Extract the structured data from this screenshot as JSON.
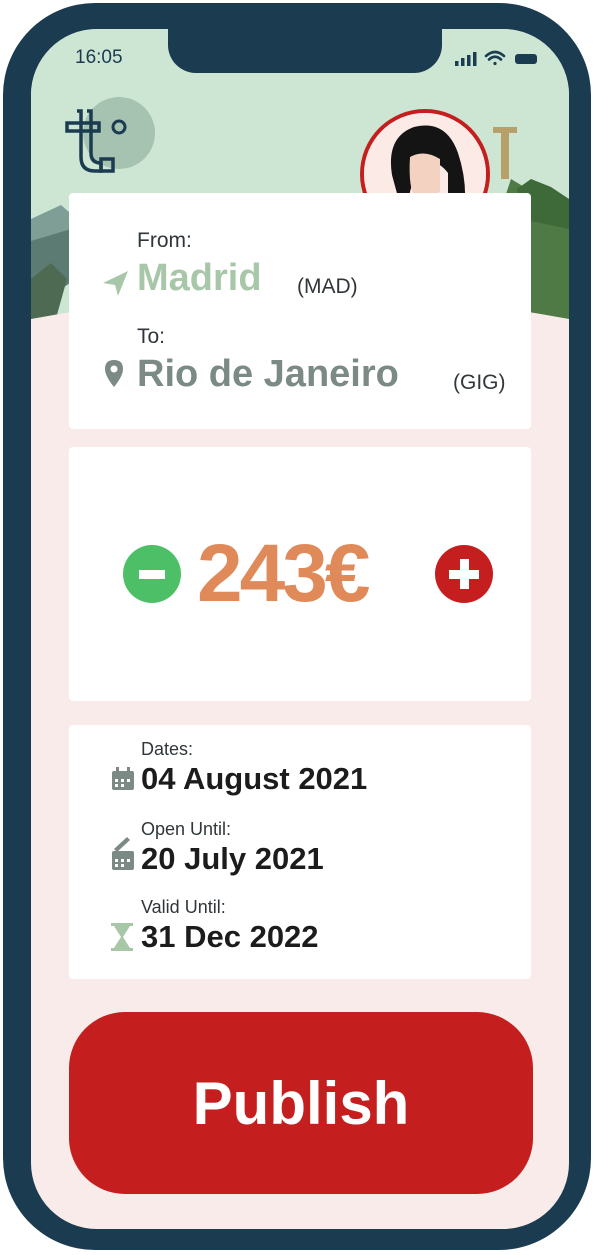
{
  "status_bar": {
    "time": "16:05"
  },
  "colors": {
    "frame": "#1b3b50",
    "accent_red": "#c41e1e",
    "price": "#e08a5a",
    "green": "#4dbf67",
    "origin": "#a8c7a8"
  },
  "route": {
    "from_label": "From:",
    "from_city": "Madrid",
    "from_code": "(MAD)",
    "to_label": "To:",
    "to_city": "Rio de Janeiro",
    "to_code": "(GIG)"
  },
  "price": {
    "value": "243€"
  },
  "dates": {
    "dates_label": "Dates:",
    "dates_value": "04 August 2021",
    "open_label": "Open Until:",
    "open_value": "20 July 2021",
    "valid_label": "Valid Until:",
    "valid_value": "31 Dec 2022"
  },
  "actions": {
    "publish_label": "Publish"
  },
  "icons": {
    "logo": "t-logo-icon",
    "origin": "navigation-arrow-icon",
    "destination": "map-pin-icon",
    "decrease": "minus-circle-icon",
    "increase": "plus-circle-icon",
    "calendar": "calendar-icon",
    "calendar_edit": "calendar-edit-icon",
    "hourglass": "hourglass-icon"
  }
}
